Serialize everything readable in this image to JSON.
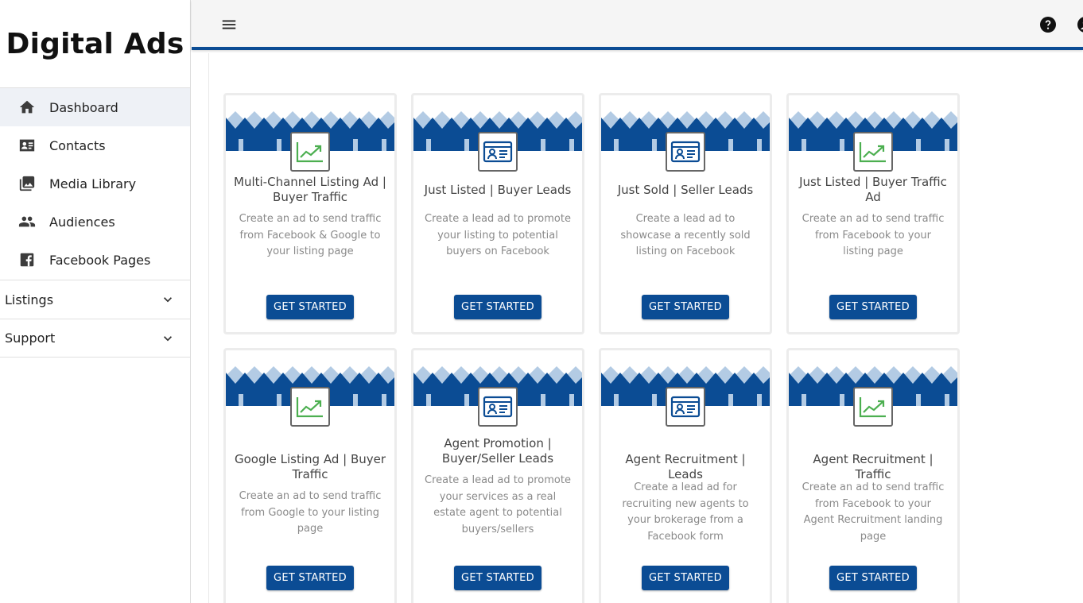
{
  "brand": {
    "title": "Digital Ads"
  },
  "sidebar": {
    "items": [
      {
        "label": "Dashboard",
        "icon": "home-icon",
        "active": true
      },
      {
        "label": "Contacts",
        "icon": "contacts-icon"
      },
      {
        "label": "Media Library",
        "icon": "photo-library-icon"
      },
      {
        "label": "Audiences",
        "icon": "people-icon"
      },
      {
        "label": "Facebook Pages",
        "icon": "facebook-icon"
      }
    ],
    "groups": [
      {
        "label": "Listings"
      },
      {
        "label": "Support"
      }
    ]
  },
  "topbar": {
    "menu_icon": "hamburger-menu-icon",
    "help_icon": "help-icon",
    "account_icon": "account-icon"
  },
  "colors": {
    "brand_blue": "#0b4c94",
    "light_blue": "#a9c3de",
    "chart_green": "#4caf50"
  },
  "cards": [
    {
      "title": "Multi-Channel Listing Ad | Buyer Traffic",
      "description": "Create an ad to send traffic from Facebook & Google to your listing page",
      "icon": "trending-chart-icon",
      "button": "GET STARTED"
    },
    {
      "title": "Just Listed | Buyer Leads",
      "description": "Create a lead ad to promote your listing to potential buyers on Facebook",
      "icon": "contact-card-icon",
      "button": "GET STARTED"
    },
    {
      "title": "Just Sold | Seller Leads",
      "description": "Create a lead ad to showcase a recently sold listing on Facebook",
      "icon": "contact-card-icon",
      "button": "GET STARTED"
    },
    {
      "title": "Just Listed | Buyer Traffic Ad",
      "description": "Create an ad to send traffic from Facebook to your listing page",
      "icon": "trending-chart-icon",
      "button": "GET STARTED"
    },
    {
      "title": "Google Listing Ad | Buyer Traffic",
      "description": "Create an ad to send traffic from Google to your listing page",
      "icon": "trending-chart-icon",
      "button": "GET STARTED"
    },
    {
      "title": "Agent Promotion | Buyer/Seller Leads",
      "description": "Create a lead ad to promote your services as a real estate agent to potential buyers/sellers",
      "icon": "contact-card-icon",
      "button": "GET STARTED"
    },
    {
      "title": "Agent Recruitment | Leads",
      "description": "Create a lead ad for recruiting new agents to your brokerage from a Facebook form",
      "icon": "contact-card-icon",
      "button": "GET STARTED"
    },
    {
      "title": "Agent Recruitment | Traffic",
      "description": "Create an ad to send traffic from Facebook to your Agent Recruitment landing page",
      "icon": "trending-chart-icon",
      "button": "GET STARTED"
    }
  ]
}
